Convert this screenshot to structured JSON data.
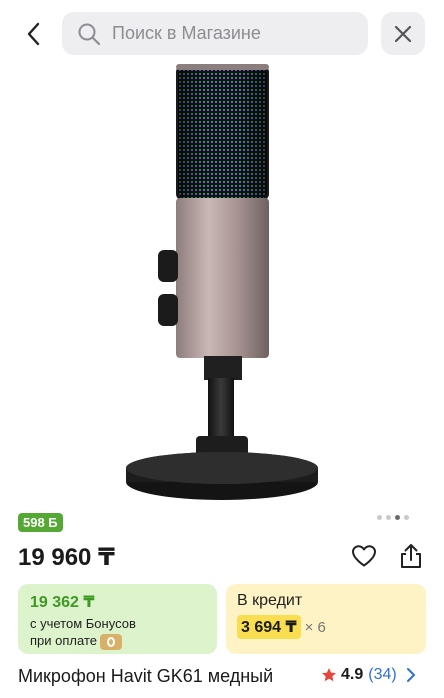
{
  "header": {
    "search_placeholder": "Поиск в Магазине"
  },
  "product": {
    "bonus_badge": "598 Б",
    "price": "19 960 ₸",
    "title": "Микрофон Havit GK61 медный",
    "rating": "4.9",
    "reviews": "(34)",
    "image_pager": {
      "count": 4,
      "active_index": 2
    }
  },
  "bonus_card": {
    "price": "19 362 ₸",
    "line1": "с учетом Бонусов",
    "line2": "при оплате"
  },
  "credit_card": {
    "title": "В кредит",
    "amount": "3 694 ₸",
    "multiplier": "× 6"
  },
  "colors": {
    "bonus_green": "#56a834",
    "bonus_card_bg": "#dcf3cc",
    "credit_card_bg": "#fdf3c4",
    "credit_highlight": "#f9df4f",
    "link_blue": "#2f70d8",
    "star_red": "#e8453c"
  },
  "icons": {
    "back": "back-arrow-icon",
    "search": "search-icon",
    "close": "close-icon",
    "favorite": "heart-icon",
    "share": "share-icon",
    "star": "star-icon",
    "chevron": "chevron-right-icon"
  }
}
